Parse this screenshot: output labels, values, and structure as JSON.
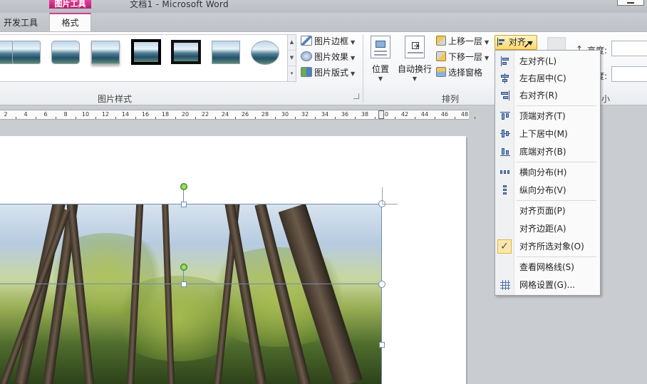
{
  "window": {
    "title": "文档1 - Microsoft Word",
    "context_tab": "图片工具"
  },
  "tabs": [
    {
      "label": "开发工具"
    },
    {
      "label": "格式"
    }
  ],
  "ribbon": {
    "picture_styles": {
      "group_label": "图片样式",
      "buttons": [
        {
          "label": "图片边框"
        },
        {
          "label": "图片效果"
        },
        {
          "label": "图片版式"
        }
      ]
    },
    "arrange": {
      "group_label": "排列",
      "position_label": "位置",
      "wrap_label": "自动换行",
      "bring_forward": "上移一层",
      "send_backward": "下移一层",
      "selection_pane": "选择窗格",
      "align_button": "对齐"
    },
    "size": {
      "height_label": "高度:",
      "width_label": "度:",
      "group_label": "小"
    }
  },
  "ruler": {
    "numbers": [
      "2",
      "4",
      "6",
      "8",
      "10",
      "12",
      "14",
      "16",
      "18",
      "20",
      "22",
      "24",
      "26",
      "28",
      "30",
      "32",
      "34",
      "36",
      "38",
      "40",
      "42",
      "44",
      "46",
      "48"
    ]
  },
  "align_menu": {
    "items": [
      {
        "label": "左对齐(L)",
        "icon": "align-left-icon"
      },
      {
        "label": "左右居中(C)",
        "icon": "align-center-icon"
      },
      {
        "label": "右对齐(R)",
        "icon": "align-right-icon"
      },
      {
        "label": "顶端对齐(T)",
        "icon": "align-top-icon"
      },
      {
        "label": "上下居中(M)",
        "icon": "align-middle-icon"
      },
      {
        "label": "底端对齐(B)",
        "icon": "align-bottom-icon"
      },
      {
        "label": "横向分布(H)",
        "icon": "distribute-horizontal-icon"
      },
      {
        "label": "纵向分布(V)",
        "icon": "distribute-vertical-icon"
      },
      {
        "label": "对齐页面(P)",
        "icon": ""
      },
      {
        "label": "对齐边距(A)",
        "icon": ""
      },
      {
        "label": "对齐所选对象(O)",
        "icon": "",
        "checked": true
      },
      {
        "label": "查看网格线(S)",
        "icon": ""
      },
      {
        "label": "网格设置(G)...",
        "icon": "grid-icon"
      }
    ]
  },
  "colors": {
    "context_tab": "#c2287c",
    "align_button_hover": "#ffd86a",
    "selection": "#6e8fb0",
    "rotate_handle": "#58b02b"
  }
}
